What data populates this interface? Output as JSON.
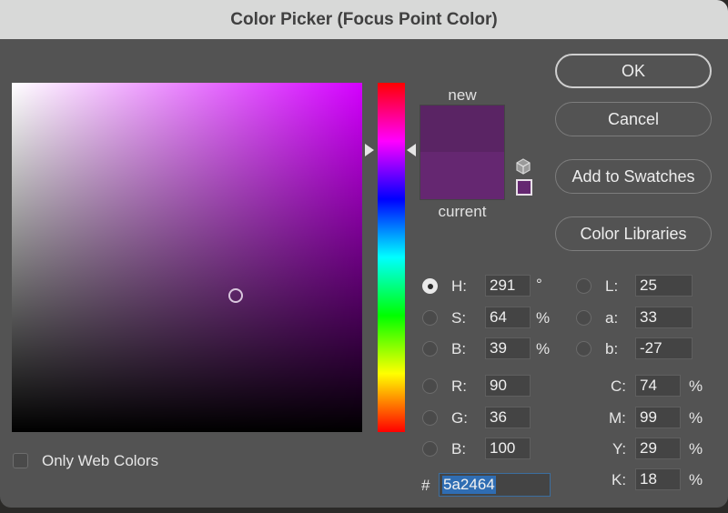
{
  "window": {
    "title": "Color Picker (Focus Point Color)"
  },
  "picker": {
    "hue_degrees": 291,
    "saturation_percent": 64,
    "brightness_percent": 39,
    "hue_base_color": "#d400ff"
  },
  "preview": {
    "new_label": "new",
    "current_label": "current",
    "new_color": "#5a2464",
    "current_color": "#652771"
  },
  "buttons": {
    "ok": "OK",
    "cancel": "Cancel",
    "add_to_swatches": "Add to Swatches",
    "color_libraries": "Color Libraries"
  },
  "hsb": {
    "h": {
      "label": "H:",
      "value": "291",
      "unit": "°",
      "selected": true
    },
    "s": {
      "label": "S:",
      "value": "64",
      "unit": "%"
    },
    "b": {
      "label": "B:",
      "value": "39",
      "unit": "%"
    }
  },
  "lab": {
    "l": {
      "label": "L:",
      "value": "25"
    },
    "a": {
      "label": "a:",
      "value": "33"
    },
    "b": {
      "label": "b:",
      "value": "-27"
    }
  },
  "rgb": {
    "r": {
      "label": "R:",
      "value": "90"
    },
    "g": {
      "label": "G:",
      "value": "36"
    },
    "b": {
      "label": "B:",
      "value": "100"
    }
  },
  "cmyk": {
    "c": {
      "label": "C:",
      "value": "74",
      "unit": "%"
    },
    "m": {
      "label": "M:",
      "value": "99",
      "unit": "%"
    },
    "y": {
      "label": "Y:",
      "value": "29",
      "unit": "%"
    },
    "k": {
      "label": "K:",
      "value": "18",
      "unit": "%"
    }
  },
  "hex": {
    "hash": "#",
    "value": "5a2464"
  },
  "only_web_colors": {
    "label": "Only Web Colors",
    "checked": false
  }
}
